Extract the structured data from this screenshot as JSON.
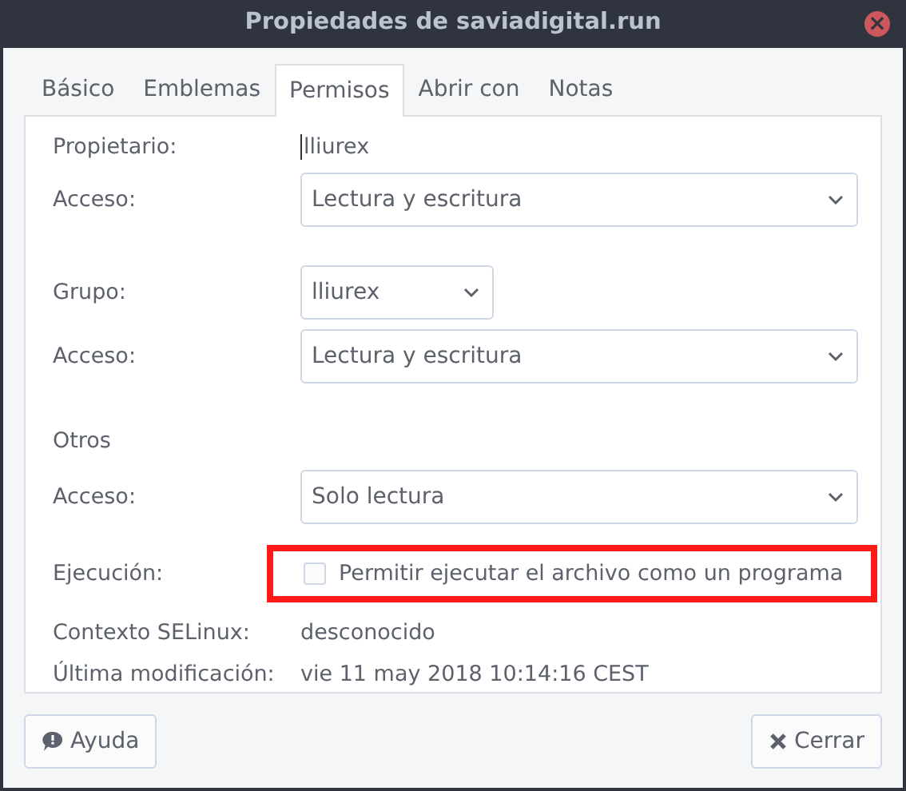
{
  "window": {
    "title": "Propiedades de saviadigital.run",
    "close_icon": "×"
  },
  "tabs": [
    {
      "label": "Básico",
      "selected": false
    },
    {
      "label": "Emblemas",
      "selected": false
    },
    {
      "label": "Permisos",
      "selected": true
    },
    {
      "label": "Abrir con",
      "selected": false
    },
    {
      "label": "Notas",
      "selected": false
    }
  ],
  "rows": [
    {
      "kind": "text",
      "label": "Propietario:",
      "value": "lliurex",
      "cursor": true
    },
    {
      "kind": "select",
      "label": "Acceso:",
      "value": "Lectura y escritura",
      "wide": true
    },
    {
      "kind": "gap"
    },
    {
      "kind": "select",
      "label": "Grupo:",
      "value": "lliurex",
      "wide": false
    },
    {
      "kind": "select",
      "label": "Acceso:",
      "value": "Lectura y escritura",
      "wide": true
    },
    {
      "kind": "gap"
    },
    {
      "kind": "heading",
      "label": "Otros"
    },
    {
      "kind": "select",
      "label": "Acceso:",
      "value": "Solo lectura",
      "wide": true
    },
    {
      "kind": "check",
      "label": "Ejecución:",
      "value": "Permitir ejecutar el archivo como un programa",
      "checked": false,
      "highlighted": true
    },
    {
      "kind": "text",
      "label": "Contexto SELinux:",
      "value": "desconocido",
      "cursor": false
    },
    {
      "kind": "text",
      "label": "Última modificación:",
      "value": "vie 11 may 2018 10:14:16 CEST",
      "cursor": false
    }
  ],
  "buttons": [
    {
      "kind": "help",
      "label": "Ayuda"
    },
    {
      "kind": "close",
      "label": "Cerrar"
    }
  ]
}
